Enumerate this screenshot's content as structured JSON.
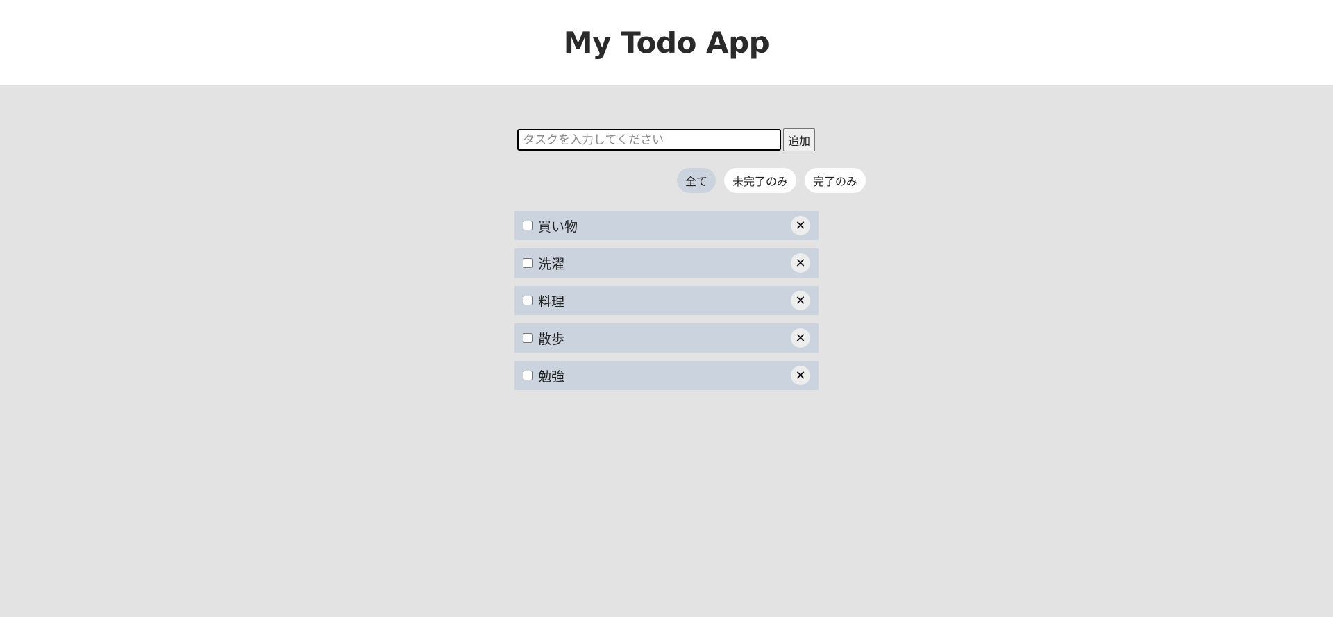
{
  "header": {
    "title": "My Todo App"
  },
  "input": {
    "placeholder": "タスクを入力してください",
    "value": "",
    "add_label": "追加"
  },
  "filters": [
    {
      "label": "全て",
      "active": true
    },
    {
      "label": "未完了のみ",
      "active": false
    },
    {
      "label": "完了のみ",
      "active": false
    }
  ],
  "todos": [
    {
      "label": "買い物",
      "done": false
    },
    {
      "label": "洗濯",
      "done": false
    },
    {
      "label": "料理",
      "done": false
    },
    {
      "label": "散歩",
      "done": false
    },
    {
      "label": "勉強",
      "done": false
    }
  ],
  "icons": {
    "delete": "close-icon"
  },
  "colors": {
    "page_bg": "#e3e3e3",
    "header_bg": "#ffffff",
    "item_bg": "#cbd3de",
    "active_filter_bg": "#cbd3de"
  }
}
